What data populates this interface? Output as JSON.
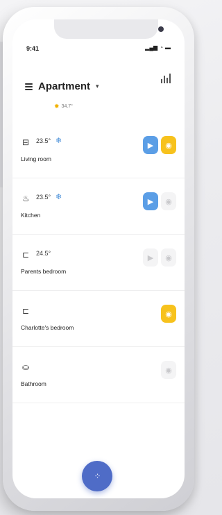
{
  "status_bar": {
    "time": "9:41",
    "signal_icon": "signal-icon",
    "wifi_icon": "wifi-icon",
    "battery_icon": "battery-icon"
  },
  "header": {
    "title": "Apartment",
    "dropdown_icon": "chevron-down-icon",
    "menu_icon": "hamburger-icon",
    "stats_icon": "bar-chart-icon"
  },
  "weather": {
    "icon": "sun-icon",
    "temperature": "34.7°"
  },
  "rooms": [
    {
      "name": "Living room",
      "temperature": "23.5°",
      "icon": "sofa-icon",
      "cooling": true,
      "media_active": true,
      "light_on": true
    },
    {
      "name": "Kitchen",
      "temperature": "23.5°",
      "icon": "cooking-pot-icon",
      "cooling": true,
      "media_active": true,
      "light_on": false
    },
    {
      "name": "Parents bedroom",
      "temperature": "24.5°",
      "icon": "bed-icon",
      "cooling": false,
      "media_active": false,
      "light_on": false
    },
    {
      "name": "Charlotte's bedroom",
      "temperature": "",
      "icon": "bed-icon",
      "cooling": false,
      "media_active": null,
      "light_on": true
    },
    {
      "name": "Bathroom",
      "temperature": "",
      "icon": "bathtub-icon",
      "cooling": false,
      "media_active": null,
      "light_on": false
    }
  ],
  "colors": {
    "accent_blue": "#5b9ee6",
    "accent_yellow": "#f7c21d",
    "fab": "#4f6cc7"
  },
  "fab": {
    "icon": "grid-dots-icon",
    "glyph": "⁘"
  }
}
